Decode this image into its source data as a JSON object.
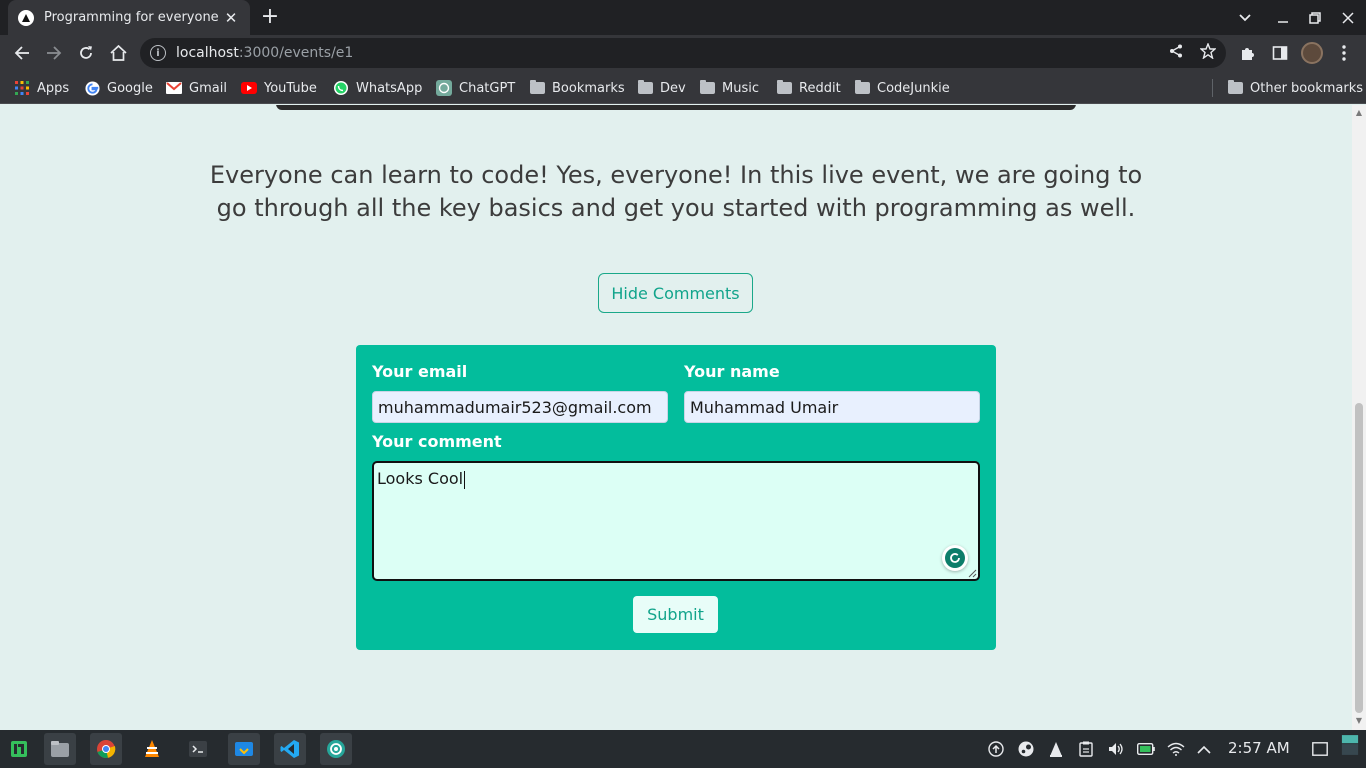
{
  "browser": {
    "tab_title": "Programming for everyone",
    "url_host": "localhost",
    "url_path": ":3000/events/e1",
    "bookmarks": [
      "Apps",
      "Google",
      "Gmail",
      "YouTube",
      "WhatsApp",
      "ChatGPT",
      "Bookmarks",
      "Dev",
      "Music",
      "Reddit",
      "CodeJunkie"
    ],
    "other_bookmarks": "Other bookmarks"
  },
  "event": {
    "description": "Everyone can learn to code! Yes, everyone! In this live event, we are going to go through all the key basics and get you started with programming as well.",
    "toggle_comments_label": "Hide Comments"
  },
  "comment_form": {
    "email_label": "Your email",
    "email_value": "muhammadumair523@gmail.com",
    "name_label": "Your name",
    "name_value": "Muhammad Umair",
    "comment_label": "Your comment",
    "comment_value": "Looks Cool",
    "submit_label": "Submit"
  },
  "taskbar": {
    "clock": "2:57 AM"
  },
  "colors": {
    "form_background": "#03bd9c",
    "accent": "#11a48b",
    "page_background": "#e2f0ee"
  }
}
